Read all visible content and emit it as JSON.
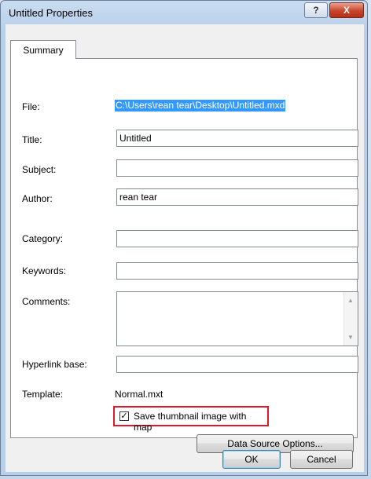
{
  "window": {
    "title": "Untitled Properties",
    "help_label": "?",
    "close_label": "X"
  },
  "tabs": [
    {
      "label": "Summary",
      "selected": true
    }
  ],
  "summary": {
    "file_label": "File:",
    "file_value": "C:\\Users\\rean tear\\Desktop\\Untitled.mxd",
    "title_label": "Title:",
    "title_value": "Untitled",
    "subject_label": "Subject:",
    "subject_value": "",
    "author_label": "Author:",
    "author_value": "rean tear",
    "category_label": "Category:",
    "category_value": "",
    "keywords_label": "Keywords:",
    "keywords_value": "",
    "comments_label": "Comments:",
    "comments_value": "",
    "hyperlink_label": "Hyperlink base:",
    "hyperlink_value": "",
    "template_label": "Template:",
    "template_value": "Normal.mxt",
    "thumbnail_label": "Save thumbnail image with map",
    "thumbnail_checked": true,
    "data_source_button": "Data Source Options..."
  },
  "footer": {
    "ok_label": "OK",
    "cancel_label": "Cancel"
  },
  "colors": {
    "highlight": "#e0182b",
    "selection": "#3399ff"
  }
}
